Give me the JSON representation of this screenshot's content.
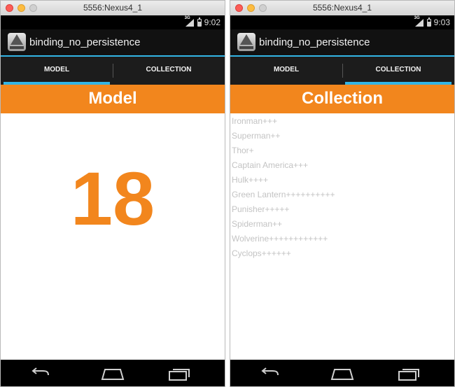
{
  "windows": [
    {
      "window_title": "5556:Nexus4_1",
      "status": {
        "time": "9:02",
        "network": "3G"
      },
      "app_title": "binding_no_persistence",
      "tabs": [
        {
          "label": "MODEL",
          "selected": true
        },
        {
          "label": "COLLECTION",
          "selected": false
        }
      ],
      "header": "Model",
      "model_value": "18"
    },
    {
      "window_title": "5556:Nexus4_1",
      "status": {
        "time": "9:03",
        "network": "3G"
      },
      "app_title": "binding_no_persistence",
      "tabs": [
        {
          "label": "MODEL",
          "selected": false
        },
        {
          "label": "COLLECTION",
          "selected": true
        }
      ],
      "header": "Collection",
      "items": [
        "Ironman+++",
        "Superman++",
        "Thor+",
        "Captain America+++",
        "Hulk++++",
        "Green Lantern++++++++++",
        "Punisher+++++",
        "Spiderman++",
        "Wolverine++++++++++++",
        "Cyclops++++++"
      ]
    }
  ],
  "colors": {
    "accent": "#f2861d",
    "tab_indicator": "#33b5e5",
    "list_text": "#c3c3c3"
  },
  "icons": [
    "app-icon",
    "signal-icon",
    "battery-icon",
    "back-icon",
    "home-icon",
    "recent-apps-icon"
  ]
}
